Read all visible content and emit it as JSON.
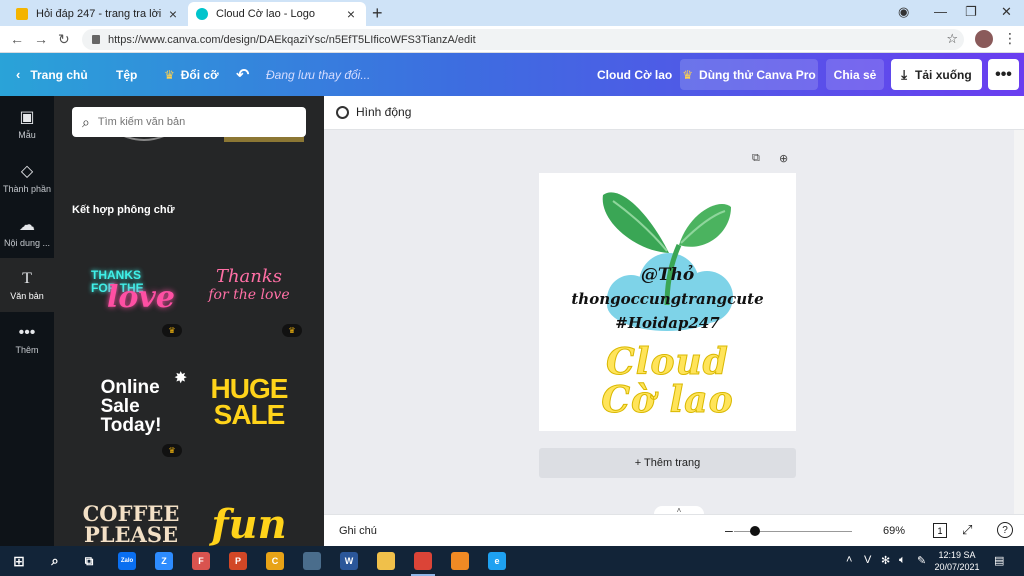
{
  "browser": {
    "tabs": [
      {
        "title": "Hỏi đáp 247 - trang tra lời",
        "favicon_color": "#f4b400"
      },
      {
        "title": "Cloud Cờ lao - Logo",
        "favicon_color": "#00c4cc"
      }
    ],
    "url": "https://www.canva.com/design/DAEkqaziYsc/n5EfT5LIficoWFS3TianzA/edit"
  },
  "canva_header": {
    "home": "Trang chủ",
    "file": "Tệp",
    "resize": "Đổi cỡ",
    "save_status": "Đang lưu thay đổi...",
    "doc_title": "Cloud Cờ lao",
    "try_pro": "Dùng thử Canva Pro",
    "share": "Chia sẻ",
    "download": "Tải xuống"
  },
  "rail": {
    "items": [
      {
        "label": "Mẫu",
        "icon": "template-icon"
      },
      {
        "label": "Thành phần",
        "icon": "elements-icon"
      },
      {
        "label": "Nội dung ...",
        "icon": "upload-icon"
      },
      {
        "label": "Văn bản",
        "icon": "text-icon"
      },
      {
        "label": "Thêm",
        "icon": "more-icon"
      }
    ]
  },
  "panel": {
    "search_placeholder": "Tìm kiếm văn bản",
    "section_title": "Kết hợp phông chữ",
    "tiles": [
      {
        "line1": "THANKS",
        "line2": "FOR THE",
        "line3": "love",
        "color": "#3ff0e8",
        "accent": "#ff4fa3",
        "pro": true
      },
      {
        "line1": "Thanks",
        "line2": "for the love",
        "color": "#ff6fa5",
        "pro": true
      },
      {
        "line1": "Online",
        "line2": "Sale",
        "line3": "Today!",
        "color": "#ffffff",
        "pro": true
      },
      {
        "line1": "HUGE",
        "line2": "SALE",
        "color": "#ffd31a",
        "pro": false
      },
      {
        "line1": "COFFEE",
        "line2": "PLEASE",
        "color": "#f3e0c6",
        "pro": false
      },
      {
        "line1": "fun",
        "color": "#ffd31a",
        "pro": false
      }
    ]
  },
  "editor": {
    "animate": "Hình động",
    "add_page": "+ Thêm trang",
    "design": {
      "line_a": "@Thỏ",
      "line_b": "thongoccungtrangcute",
      "line_c": "#Hoidap247",
      "title_1": "Cloud",
      "title_2": "Cờ lao",
      "title_color": "#ffe45a",
      "leaf_color": "#3aa655",
      "cloud_color": "#7ed3e8"
    }
  },
  "bottom": {
    "notes": "Ghi chú",
    "zoom": "69%",
    "zoom_level": 0.69,
    "page_count": "1"
  },
  "taskbar": {
    "time": "12:19 SA",
    "date": "20/07/2021",
    "apps": [
      {
        "name": "zalo",
        "label": "Zalo",
        "color": "#0a6ff0"
      },
      {
        "name": "zoom",
        "label": "Z",
        "color": "#2d8cff"
      },
      {
        "name": "file-tool",
        "label": "F",
        "color": "#d9534f"
      },
      {
        "name": "powerpoint",
        "label": "P",
        "color": "#d24726"
      },
      {
        "name": "chrome-canary",
        "label": "C",
        "color": "#e8a317"
      },
      {
        "name": "app6",
        "label": "",
        "color": "#4a6d8c"
      },
      {
        "name": "word",
        "label": "W",
        "color": "#2b579a"
      },
      {
        "name": "explorer",
        "label": "",
        "color": "#f0c04a"
      },
      {
        "name": "chrome",
        "label": "",
        "color": "#db4437"
      },
      {
        "name": "app10",
        "label": "",
        "color": "#f08a24"
      },
      {
        "name": "ie",
        "label": "e",
        "color": "#1ea1f1"
      }
    ],
    "tray": "V"
  }
}
